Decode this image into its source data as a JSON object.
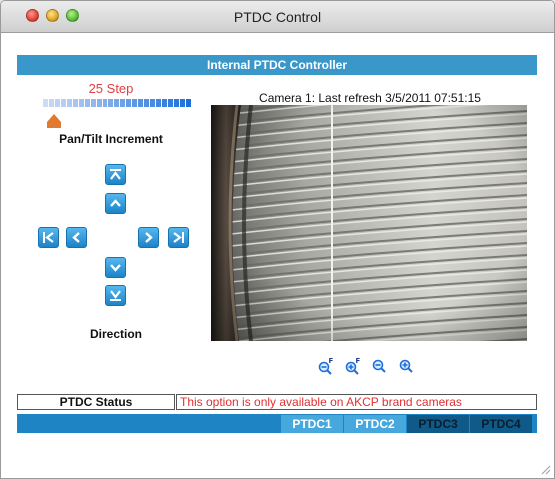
{
  "window": {
    "title": "PTDC Control"
  },
  "header": {
    "title": "Internal PTDC Controller"
  },
  "pan_tilt": {
    "step_label": "25 Step",
    "increment_label": "Pan/Tilt Increment",
    "slider_value": 0.0,
    "bar_color": "#1e6fd9"
  },
  "direction": {
    "label": "Direction",
    "buttons": [
      {
        "name": "tilt-full-up",
        "icon": "double-up-arrow"
      },
      {
        "name": "tilt-up",
        "icon": "up-arrow"
      },
      {
        "name": "pan-full-left",
        "icon": "double-left-arrow"
      },
      {
        "name": "pan-left",
        "icon": "left-arrow"
      },
      {
        "name": "pan-right",
        "icon": "right-arrow"
      },
      {
        "name": "pan-full-right",
        "icon": "double-right-arrow"
      },
      {
        "name": "tilt-down",
        "icon": "down-arrow"
      },
      {
        "name": "tilt-full-down",
        "icon": "double-down-arrow"
      }
    ]
  },
  "camera": {
    "caption": "Camera 1: Last refresh 3/5/2011 07:51:15"
  },
  "zoom": [
    {
      "name": "focus-out",
      "icon": "focus-out-icon",
      "badge": "F"
    },
    {
      "name": "focus-in",
      "icon": "focus-in-icon",
      "badge": "F"
    },
    {
      "name": "zoom-out",
      "icon": "zoom-out-icon"
    },
    {
      "name": "zoom-in",
      "icon": "zoom-in-icon"
    }
  ],
  "status": {
    "label": "PTDC Status",
    "text": "This option is only available on AKCP brand cameras"
  },
  "tabs": [
    {
      "label": "PTDC1",
      "active": true
    },
    {
      "label": "PTDC2",
      "active": true
    },
    {
      "label": "PTDC3",
      "active": false
    },
    {
      "label": "PTDC4",
      "active": false
    }
  ],
  "colors": {
    "accent": "#3a97c9",
    "warning": "#e03030",
    "button": "#1c83c9"
  }
}
